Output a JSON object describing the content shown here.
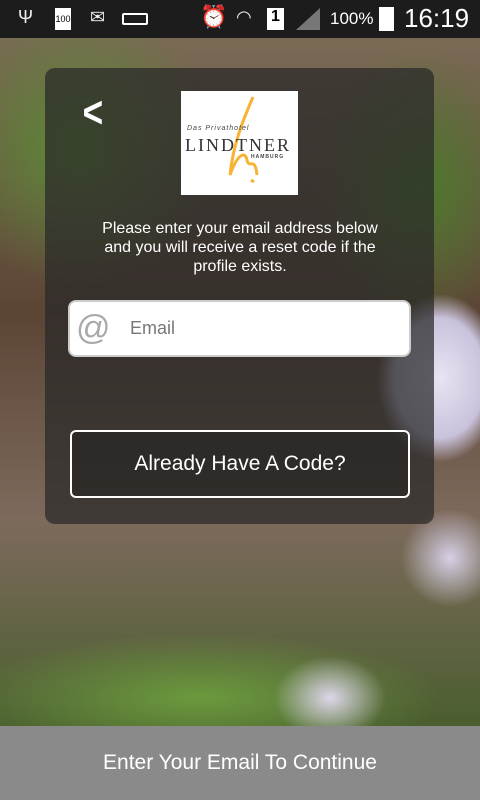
{
  "status_bar": {
    "battery_badge": "100",
    "battery_percent": "100%",
    "time": "16:19",
    "sim": "1",
    "icons": [
      "usb-icon",
      "battery-100-icon",
      "outlook-icon",
      "voicemail-icon",
      "alarm-icon",
      "wifi-icon",
      "sim-icon",
      "signal-icon",
      "battery-icon"
    ]
  },
  "logo": {
    "line1": "Das Privathotel",
    "line2": "LINDTNER",
    "line3": "HAMBURG",
    "accent": "#f7b332"
  },
  "message": "Please enter your email address below and you will receive a reset code if the profile exists.",
  "email": {
    "placeholder": "Email",
    "value": ""
  },
  "code_button": "Already Have A Code?",
  "continue_button": "Enter Your Email To Continue"
}
